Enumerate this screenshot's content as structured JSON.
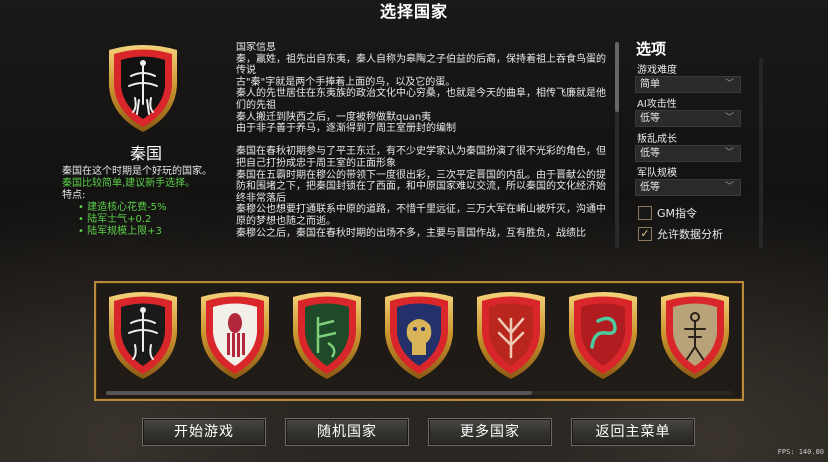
{
  "header": {
    "title": "选择国家"
  },
  "selected_nation": {
    "name": "秦国",
    "summary": "秦国在这个时期是个好玩的国家。",
    "difficulty_note": "秦国比较简单,建议新手选择。",
    "traits_label": "特点:",
    "traits": [
      "建造核心花费-5%",
      "陆军士气+0.2",
      "陆军规模上限+3"
    ],
    "emblem": "bird-emblem-shield"
  },
  "nation_info": {
    "lines": [
      "国家信息",
      "秦，嬴姓，祖先出自东夷，秦人自称为皋陶之子伯益的后裔，保持着祖上吞食鸟蛋的传说",
      "古\"秦\"字就是两个手捧着上面的鸟，以及它的蛋。",
      "秦人的先世居住在东夷族的政治文化中心穷桑，也就是今天的曲阜，相传飞廉就是他们的先祖",
      "秦人搬迁到陕西之后，一度被称做默quan夷",
      "由于非子善于养马，逐渐得到了周王室册封的编制",
      "",
      "秦国在春秋初期参与了平王东迁，有不少史学家认为秦国扮演了很不光彩的角色，但把自己打扮成忠于周王室的正面形象",
      "秦国在五霸时期在穆公的带领下一度很出彩，三次平定晋国的内乱。由于晋献公的提防和围堵之下，把秦国封锁在了西面，和中原国家难以交流，所以秦国的文化经济始终非常落后",
      "秦穆公也想要打通联系中原的道路，不惜千里远征，三万大军在崤山被歼灭，沟通中原的梦想也随之而逝。",
      "秦穆公之后，秦国在春秋时期的出场不多，主要与晋国作战，互有胜负，战绩比"
    ]
  },
  "options": {
    "title": "选项",
    "settings": [
      {
        "label": "游戏难度",
        "value": "简单"
      },
      {
        "label": "AI攻击性",
        "value": "低等"
      },
      {
        "label": "叛乱成长",
        "value": "低等"
      },
      {
        "label": "军队规模",
        "value": "低等"
      }
    ],
    "checkboxes": [
      {
        "label": "GM指令",
        "checked": false,
        "mark": ""
      },
      {
        "label": "允许数据分析",
        "checked": true,
        "mark": "✓"
      }
    ]
  },
  "nations": [
    {
      "emblem": "bird-emblem-shield",
      "field": "#1a1a1a",
      "rim": "#d8262a"
    },
    {
      "emblem": "squid-emblem-shield",
      "field": "#f2efe8",
      "rim": "#d8262a"
    },
    {
      "emblem": "green-rune-emblem-shield",
      "field": "#1f4a2a",
      "rim": "#d8262a"
    },
    {
      "emblem": "blue-beast-emblem-shield",
      "field": "#23306a",
      "rim": "#d8262a"
    },
    {
      "emblem": "red-tree-emblem-shield",
      "field": "#b8261e",
      "rim": "#d8262a"
    },
    {
      "emblem": "serpent-emblem-shield",
      "field": "#b01c20",
      "rim": "#d8262a"
    },
    {
      "emblem": "figure-emblem-shield",
      "field": "#b8a27a",
      "rim": "#d8262a"
    }
  ],
  "buttons": {
    "start": "开始游戏",
    "random": "随机国家",
    "more": "更多国家",
    "back": "返回主菜单"
  },
  "fps": "FPS: 140.80"
}
